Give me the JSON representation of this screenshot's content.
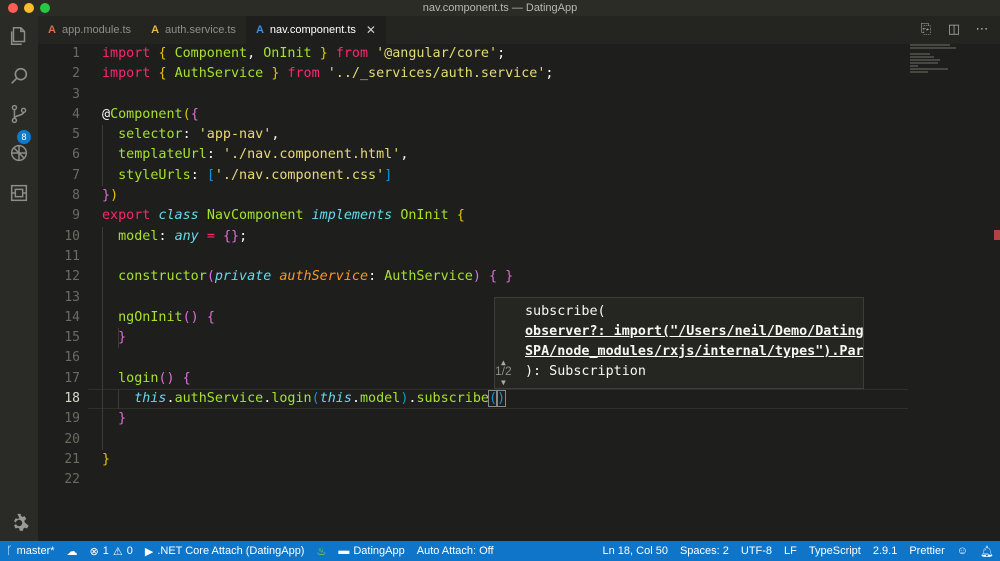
{
  "window": {
    "title": "nav.component.ts — DatingApp"
  },
  "activity_bar": {
    "scm_badge": "8"
  },
  "tabs": [
    {
      "label": "app.module.ts",
      "icon": "angular-icon",
      "color": "#e06c4c"
    },
    {
      "label": "auth.service.ts",
      "icon": "angular-icon",
      "color": "#e9b83c"
    },
    {
      "label": "nav.component.ts",
      "icon": "angular-icon",
      "color": "#3e8fe0",
      "active": true
    }
  ],
  "editor": {
    "current_line": 18,
    "line_numbers": [
      "1",
      "2",
      "3",
      "4",
      "5",
      "6",
      "7",
      "8",
      "9",
      "10",
      "11",
      "12",
      "13",
      "14",
      "15",
      "16",
      "17",
      "18",
      "19",
      "20",
      "21",
      "22"
    ]
  },
  "hint": {
    "line1": "subscribe(",
    "line2": "observer?: import(\"/Users/neil/Demo/DatingA",
    "line3": "SPA/node_modules/rxjs/internal/types\").Part",
    "line4": "): Subscription",
    "pager": "1/2"
  },
  "statusbar": {
    "branch": "master*",
    "errors": "1",
    "warnings": "0",
    "debug": ".NET Core Attach (DatingApp)",
    "folder": "DatingApp",
    "auto_attach": "Auto Attach: Off",
    "position": "Ln 18, Col 50",
    "spaces": "Spaces: 2",
    "encoding": "UTF-8",
    "eol": "LF",
    "language": "TypeScript",
    "version": "2.9.1",
    "formatter": "Prettier"
  },
  "colors": {
    "statusbar": "#0e75c9",
    "editor_bg": "#1e1f1c",
    "keyword": "#f92672",
    "string": "#e6db74",
    "class": "#a6e22e"
  }
}
